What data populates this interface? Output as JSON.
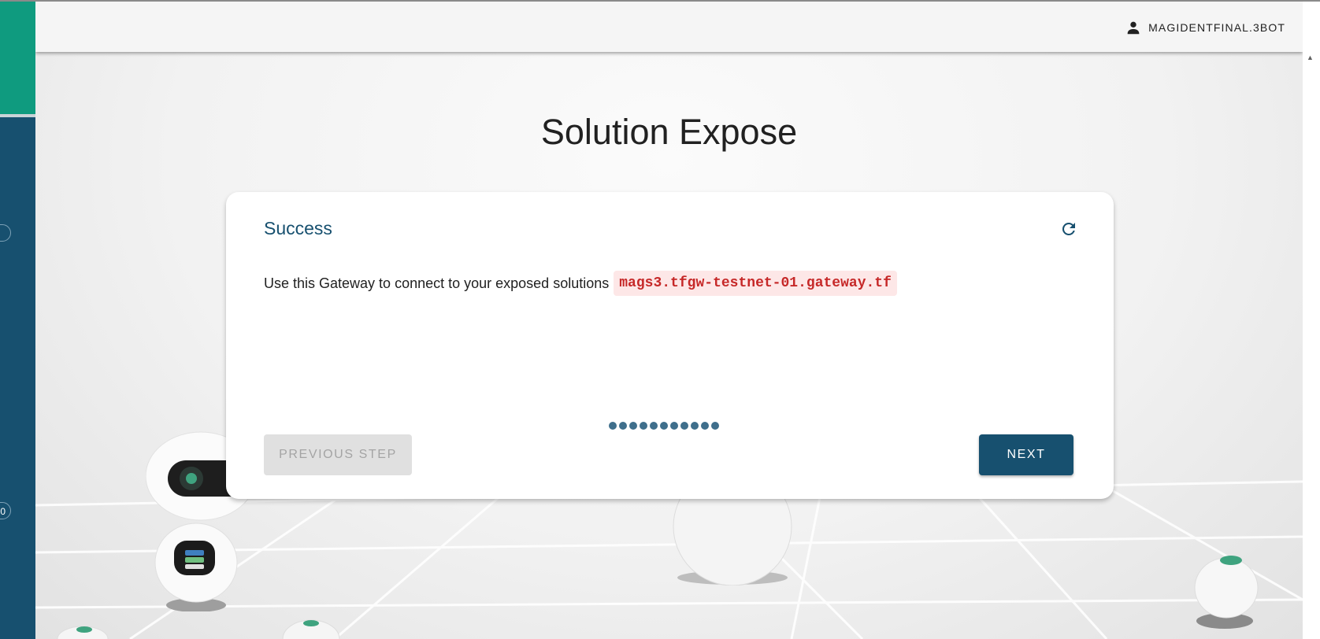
{
  "header": {
    "user_name": "MAGIDENTFINAL.3BOT",
    "user_icon": "account-icon"
  },
  "sidebar": {
    "badges": [
      "",
      "0"
    ]
  },
  "page": {
    "title": "Solution Expose"
  },
  "card": {
    "title": "Success",
    "refresh_icon": "refresh-icon",
    "message": "Use this Gateway to connect to your exposed solutions",
    "gateway": "mags3.tfgw-testnet-01.gateway.tf",
    "step_count": 11,
    "buttons": {
      "previous": "PREVIOUS STEP",
      "next": "NEXT"
    }
  },
  "colors": {
    "primary": "#17506f",
    "accent_green": "#0f9b7f",
    "code_red": "#c62828",
    "code_bg": "#fde7e7"
  }
}
